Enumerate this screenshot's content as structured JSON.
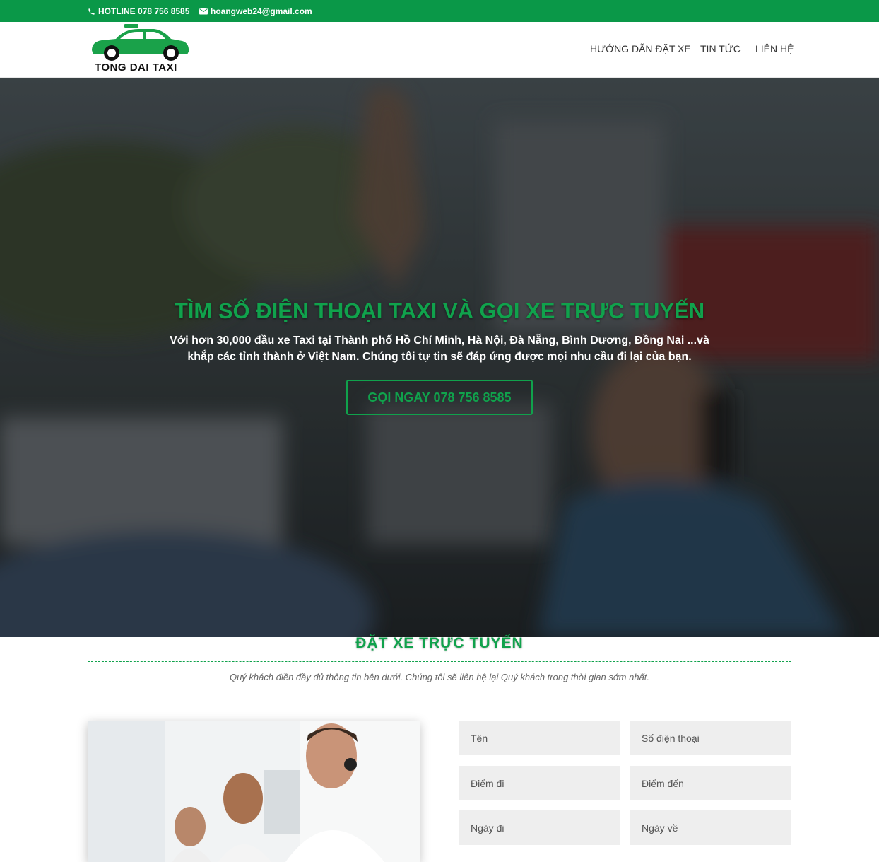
{
  "topbar": {
    "hotline": "HOTLINE 078 756 8585",
    "email": "hoangweb24@gmail.com",
    "background": "#0a9848"
  },
  "header": {
    "logo_text": "TONG DAI TAXI",
    "nav": [
      "HƯỚNG DẪN ĐẶT XE",
      "TIN TỨC",
      "LIÊN HỆ"
    ]
  },
  "hero": {
    "title": "TÌM SỐ ĐIỆN THOẠI TAXI VÀ GỌI XE TRỰC TUYẾN",
    "subtitle": "Với hơn 30,000 đầu xe Taxi tại Thành phố Hồ Chí Minh, Hà Nội, Đà Nẵng, Bình Dương, Đồng Nai ...và khắp các tỉnh thành ở Việt Nam. Chúng tôi tự tin sẽ đáp ứng được mọi nhu cầu đi lại của bạn.",
    "button": "GỌI NGAY 078 756 8585",
    "accent": "#10a24c"
  },
  "booking": {
    "title": "ĐẶT XE TRỰC TUYẾN",
    "description": "Quý khách điền đầy đủ thông tin bên dưới. Chúng tôi sẽ liên hệ lại Quý khách trong thời gian sớm nhất.",
    "fields": {
      "name": "Tên",
      "phone": "Số điện thoại",
      "from": "Điểm đi",
      "to": "Điểm đến",
      "depart_date": "Ngày đi",
      "return_date": "Ngày về"
    }
  }
}
